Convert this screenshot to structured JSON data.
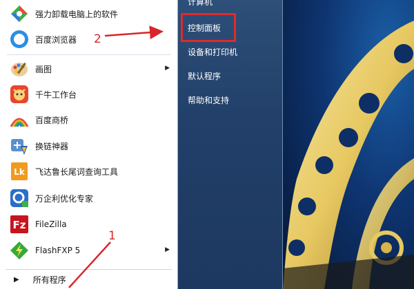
{
  "left_pane": {
    "items": [
      {
        "label": "强力卸载电脑上的软件",
        "icon": "uninstaller-icon"
      },
      {
        "label": "百度浏览器",
        "icon": "baidu-browser-icon"
      },
      {
        "label": "画图",
        "icon": "paint-icon",
        "has_submenu": true
      },
      {
        "label": "千牛工作台",
        "icon": "qianniu-icon"
      },
      {
        "label": "百度商桥",
        "icon": "baidu-shangqiao-icon"
      },
      {
        "label": "换链神器",
        "icon": "link-tool-icon"
      },
      {
        "label": "飞达鲁长尾词查询工具",
        "icon": "feidalu-icon"
      },
      {
        "label": "万企利优化专家",
        "icon": "optimizer-icon"
      },
      {
        "label": "FileZilla",
        "icon": "filezilla-icon"
      },
      {
        "label": "FlashFXP 5",
        "icon": "flashfxp-icon",
        "has_submenu": true
      }
    ],
    "all_programs": "所有程序"
  },
  "right_pane": {
    "items": [
      "计算机",
      "控制面板",
      "设备和打印机",
      "默认程序",
      "帮助和支持"
    ]
  },
  "annotations": {
    "step1": "1",
    "step2": "2",
    "color": "#d8262b"
  },
  "colors": {
    "right_pane": "#22406a",
    "highlight": "#e02a2a"
  }
}
